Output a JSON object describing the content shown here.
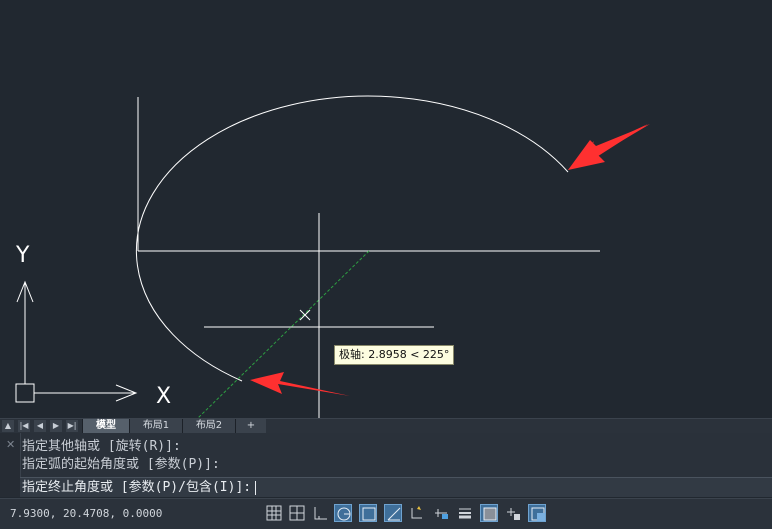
{
  "viewport": {
    "axis_y_label": "Y",
    "axis_x_label": "X",
    "tooltip": "极轴: 2.8958 < 225°"
  },
  "tabs": {
    "items": [
      {
        "label": "模型",
        "active": true
      },
      {
        "label": "布局1",
        "active": false
      },
      {
        "label": "布局2",
        "active": false
      },
      {
        "label": "+",
        "active": false
      }
    ]
  },
  "command": {
    "history": [
      "指定其他轴或 [旋转(R)]:",
      "指定弧的起始角度或 [参数(P)]:"
    ],
    "prompt": "指定终止角度或 [参数(P)/包含(I)]:"
  },
  "status": {
    "coordinates": "7.9300, 20.4708, 0.0000"
  },
  "colors": {
    "background": "#212830",
    "drawing": "#ffffff",
    "tracking": "#2ea043",
    "annotation_arrow": "#ff3030",
    "active_toggle": "#3f6f9a"
  }
}
